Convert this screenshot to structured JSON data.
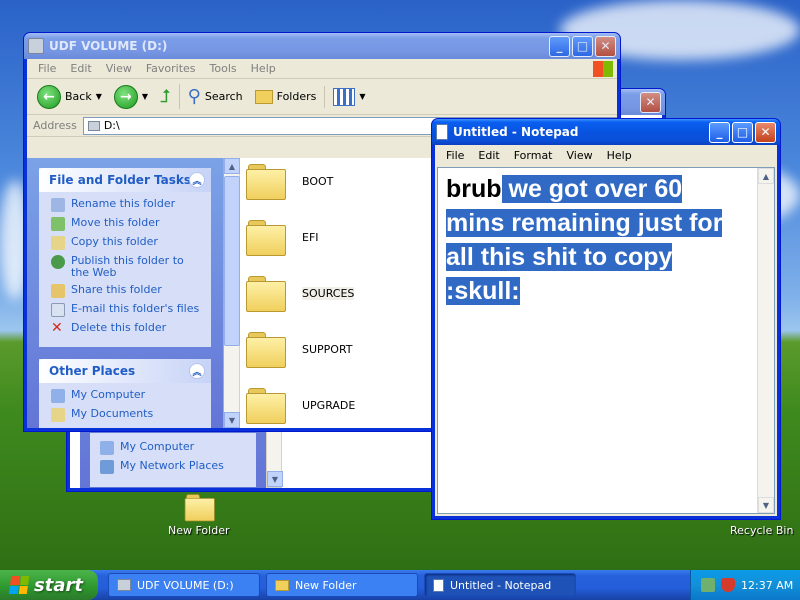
{
  "explorer_back": {
    "places": [
      "My Computer",
      "My Network Places"
    ]
  },
  "explorer": {
    "title": "UDF VOLUME (D:)",
    "menu": [
      "File",
      "Edit",
      "View",
      "Favorites",
      "Tools",
      "Help"
    ],
    "toolbar": {
      "back": "Back",
      "search": "Search",
      "folders": "Folders"
    },
    "address_label": "Address",
    "address_value": "D:\\",
    "tasks_header": "File and Folder Tasks",
    "tasks": [
      {
        "label": "Rename this folder",
        "icon": "rename-icon"
      },
      {
        "label": "Move this folder",
        "icon": "move-icon"
      },
      {
        "label": "Copy this folder",
        "icon": "copy-icon"
      },
      {
        "label": "Publish this folder to the Web",
        "icon": "globe-icon"
      },
      {
        "label": "Share this folder",
        "icon": "share-icon"
      },
      {
        "label": "E-mail this folder's files",
        "icon": "email-icon"
      },
      {
        "label": "Delete this folder",
        "icon": "delete-icon"
      }
    ],
    "places_header": "Other Places",
    "places": [
      "My Computer",
      "My Documents"
    ],
    "folders": [
      "BOOT",
      "EFI",
      "SOURCES",
      "SUPPORT",
      "UPGRADE"
    ]
  },
  "notepad": {
    "title": "Untitled - Notepad",
    "menu": [
      "File",
      "Edit",
      "Format",
      "View",
      "Help"
    ],
    "text_unselected": "brub",
    "text_selected": " we got over 60 mins remaining just for all this shit to copy :skull:"
  },
  "desktop_icons": {
    "new_folder": "New Folder",
    "recycle_bin": "Recycle Bin"
  },
  "taskbar": {
    "start": "start",
    "buttons": [
      "UDF VOLUME (D:)",
      "New Folder",
      "Untitled - Notepad"
    ],
    "active_index": 2,
    "clock": "12:37 AM"
  },
  "colors": {
    "selection": "#316ac5",
    "title_active": "#0a5ff0",
    "link": "#215dc6"
  }
}
